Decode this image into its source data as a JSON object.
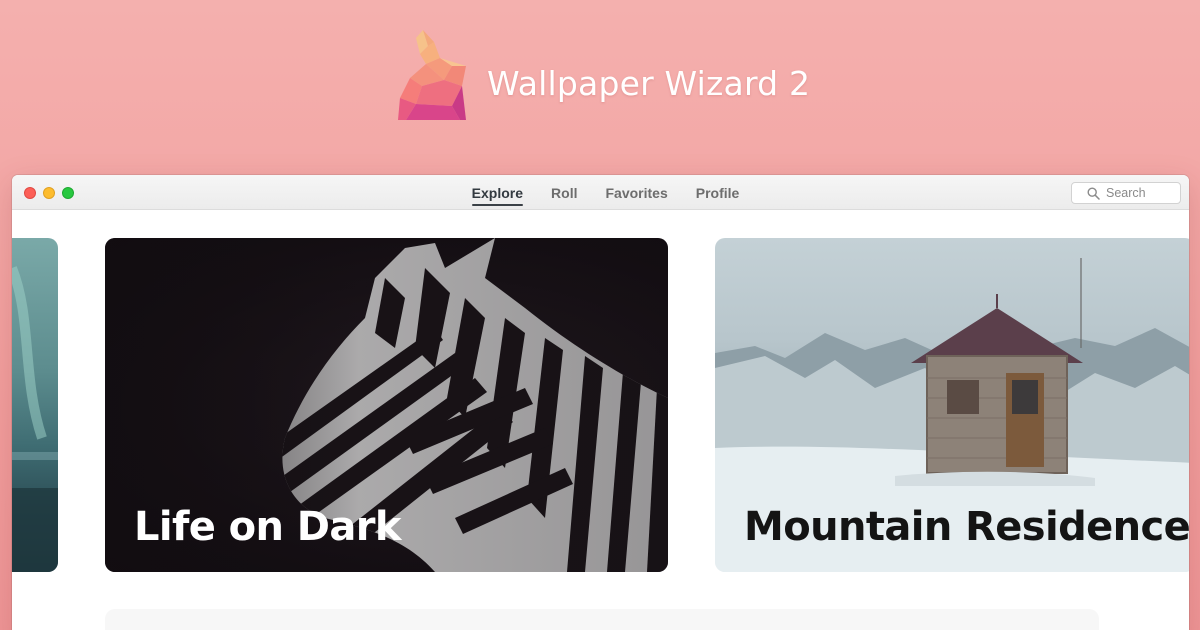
{
  "app": {
    "title": "Wallpaper Wizard 2",
    "logo_icon": "origami-rabbit-icon"
  },
  "toolbar": {
    "tabs": [
      {
        "label": "Explore",
        "active": true
      },
      {
        "label": "Roll",
        "active": false
      },
      {
        "label": "Favorites",
        "active": false
      },
      {
        "label": "Profile",
        "active": false
      }
    ],
    "search": {
      "placeholder": "Search",
      "icon": "search-icon"
    }
  },
  "collections": [
    {
      "title": "Life on Dark",
      "image": "zebra-image"
    },
    {
      "title": "Mountain Residence",
      "image": "mountain-cabin-image"
    }
  ],
  "colors": {
    "background": "#f29f9e",
    "close": "#fc5f57",
    "minimize": "#fdbc2e",
    "maximize": "#28c840"
  }
}
